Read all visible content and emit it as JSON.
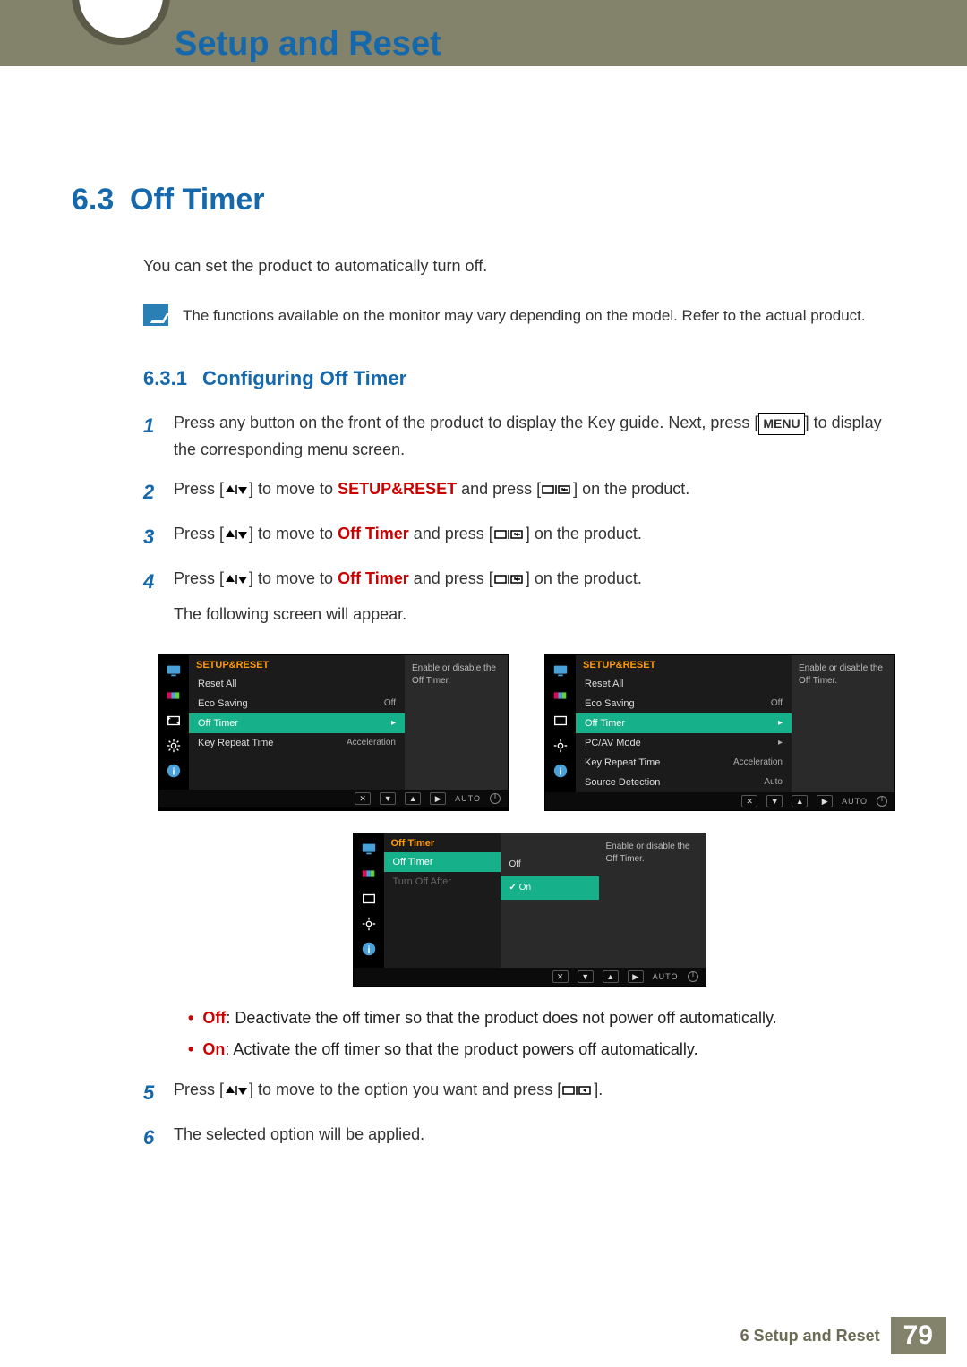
{
  "header": {
    "chapter_title": "Setup and Reset"
  },
  "section": {
    "number": "6.3",
    "title": "Off Timer"
  },
  "intro": "You can set the product to automatically turn off.",
  "note": "The functions available on the monitor may vary depending on the model. Refer to the actual product.",
  "subsection": {
    "number": "6.3.1",
    "title": "Configuring Off Timer"
  },
  "steps": {
    "s1": {
      "num": "1",
      "pre": "Press any button on the front of the product to display the Key guide. Next, press [",
      "menu": "MENU",
      "post": "] to display the corresponding menu screen."
    },
    "s2": {
      "num": "2",
      "pre": "Press [",
      "mid1": "] to move to ",
      "bold": "SETUP&RESET",
      "mid2": " and press [",
      "post": "] on the product."
    },
    "s3": {
      "num": "3",
      "pre": "Press [",
      "mid1": "] to move to ",
      "bold": "Off Timer",
      "mid2": " and press [",
      "post": "] on the product."
    },
    "s4": {
      "num": "4",
      "pre": "Press [",
      "mid1": "] to move to ",
      "bold": "Off Timer",
      "mid2": " and press [",
      "post": "] on the product.",
      "line2": "The following screen will appear."
    },
    "s5": {
      "num": "5",
      "pre": "Press [",
      "mid1": "] to move to the option you want and press [",
      "post": "]."
    },
    "s6": {
      "num": "6",
      "text": "The selected option will be applied."
    }
  },
  "bullets": {
    "off_label": "Off",
    "off_text": ": Deactivate the off timer so that the product does not power off automatically.",
    "on_label": "On",
    "on_text": ": Activate the off timer so that the product powers off automatically."
  },
  "osd": {
    "help": "Enable or disable the Off Timer.",
    "menu1": {
      "hdr": "SETUP&RESET",
      "rows": [
        {
          "label": "Reset All",
          "val": ""
        },
        {
          "label": "Eco Saving",
          "val": "Off"
        },
        {
          "label": "Off Timer",
          "val": "▸",
          "hl": true
        },
        {
          "label": "Key Repeat Time",
          "val": "Acceleration"
        }
      ]
    },
    "menu2": {
      "hdr": "SETUP&RESET",
      "rows": [
        {
          "label": "Reset All",
          "val": ""
        },
        {
          "label": "Eco Saving",
          "val": "Off"
        },
        {
          "label": "Off Timer",
          "val": "▸",
          "hl": true
        },
        {
          "label": "PC/AV Mode",
          "val": "▸"
        },
        {
          "label": "Key Repeat Time",
          "val": "Acceleration"
        },
        {
          "label": "Source Detection",
          "val": "Auto"
        }
      ]
    },
    "menu3": {
      "hdr": "Off Timer",
      "rows": [
        {
          "label": "Off Timer",
          "val": "",
          "hl": true
        },
        {
          "label": "Turn Off After",
          "val": ""
        }
      ],
      "options": [
        {
          "label": "Off",
          "hl": false
        },
        {
          "label": "On",
          "hl": true
        }
      ]
    },
    "footer_auto": "AUTO"
  },
  "footer": {
    "chapter": "6 Setup and Reset",
    "page": "79"
  }
}
